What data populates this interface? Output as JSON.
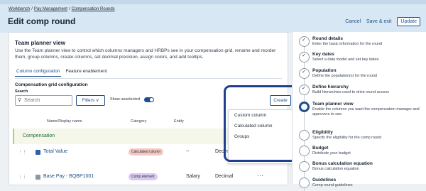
{
  "breadcrumbs": [
    "Workbench",
    "Pay Management",
    "Compensation Rounds"
  ],
  "page_title": "Edit comp round",
  "header_actions": {
    "cancel": "Cancel",
    "save_exit": "Save & exit",
    "update": "Update"
  },
  "panel": {
    "title": "Team planner view",
    "description": "Use the Team planner view to control which columns managers and HRBPs see in your compensation grid, rename and reorder them, group columns, create columns, set decimal precision, assign colors, and add tooltips."
  },
  "tabs": [
    {
      "label": "Column configuration",
      "active": true
    },
    {
      "label": "Feature enablement",
      "active": false
    }
  ],
  "grid_config": {
    "title": "Compensation grid configuration",
    "search_label": "Search",
    "search_placeholder": "Search",
    "filters_label": "Filters",
    "show_unselected_label": "Show unselected",
    "show_unselected_on": true,
    "create_label": "Create"
  },
  "create_menu": {
    "items": [
      "Custom column",
      "Calculated column"
    ],
    "overflow_text": "Groups"
  },
  "table": {
    "headers": [
      "Name/Display name",
      "Category",
      "Entity"
    ],
    "section": "Compensation",
    "rows": [
      {
        "name": "Total Value",
        "category": "Calculated column",
        "category_color": "#f4c7c0",
        "entity": "--",
        "type": "Decimal",
        "checkbox_color": "#2f5fa8"
      },
      {
        "name": "Base Pay - BQBP1001",
        "category": "Comp element",
        "category_color": "#d9c8ef",
        "entity": "Salary",
        "type": "Decimal",
        "checkbox_color": "#8c97a3"
      }
    ]
  },
  "steps": [
    {
      "title": "Round details",
      "desc": "Enter the basic information for the round",
      "done": true,
      "active": false
    },
    {
      "title": "Key dates",
      "desc": "Select a data model and set key dates.",
      "done": true,
      "active": false
    },
    {
      "title": "Population",
      "desc": "Define the population(s) for the round",
      "done": true,
      "active": false
    },
    {
      "title": "Define hierarchy",
      "desc": "Build hierarchies used to drive round access",
      "done": true,
      "active": false
    },
    {
      "title": "Team planner view",
      "desc": "Enable the columns you want the compensation manager and approvers to see.",
      "done": false,
      "active": true
    },
    {
      "title": "Eligibility",
      "desc": "Specify the eligibility for the comp round",
      "done": false,
      "active": false
    },
    {
      "title": "Budget",
      "desc": "Distribute your budget",
      "done": false,
      "active": false
    },
    {
      "title": "Bonus calculation equation",
      "desc": "Bonus calculation equation",
      "done": false,
      "active": false
    },
    {
      "title": "Guidelines",
      "desc": "Comp round guidelines",
      "done": false,
      "active": false
    }
  ],
  "colors": {
    "accent": "#1e4f8a",
    "header_bg": "#d7e7f3",
    "highlight": "#1f3f8f"
  }
}
